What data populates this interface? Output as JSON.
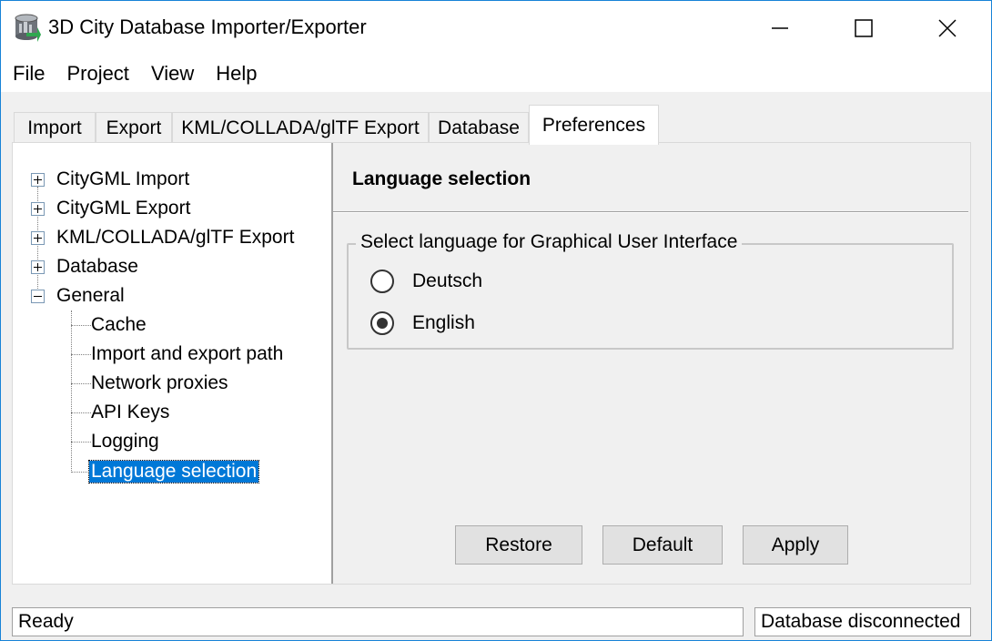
{
  "window": {
    "title": "3D City Database Importer/Exporter",
    "app_icon": "database-globe-icon"
  },
  "menu": [
    "File",
    "Project",
    "View",
    "Help"
  ],
  "tabs": [
    {
      "label": "Import",
      "active": false
    },
    {
      "label": "Export",
      "active": false
    },
    {
      "label": "KML/COLLADA/glTF Export",
      "active": false
    },
    {
      "label": "Database",
      "active": false
    },
    {
      "label": "Preferences",
      "active": true
    }
  ],
  "tree": {
    "top_items": [
      {
        "label": "CityGML Import",
        "expanded": false
      },
      {
        "label": "CityGML Export",
        "expanded": false
      },
      {
        "label": "KML/COLLADA/glTF Export",
        "expanded": false
      },
      {
        "label": "Database",
        "expanded": false
      },
      {
        "label": "General",
        "expanded": true
      }
    ],
    "general_children": [
      {
        "label": "Cache"
      },
      {
        "label": "Import and export path"
      },
      {
        "label": "Network proxies"
      },
      {
        "label": "API Keys"
      },
      {
        "label": "Logging"
      },
      {
        "label": "Language selection",
        "selected": true
      }
    ]
  },
  "panel": {
    "title": "Language selection",
    "group_title": "Select language for Graphical User Interface",
    "options": [
      {
        "label": "Deutsch",
        "checked": false
      },
      {
        "label": "English",
        "checked": true
      }
    ],
    "buttons": {
      "restore": "Restore",
      "default": "Default",
      "apply": "Apply"
    }
  },
  "status": {
    "left": "Ready",
    "right": "Database disconnected"
  },
  "colors": {
    "selection": "#0078d7",
    "window_border": "#1883d7"
  }
}
